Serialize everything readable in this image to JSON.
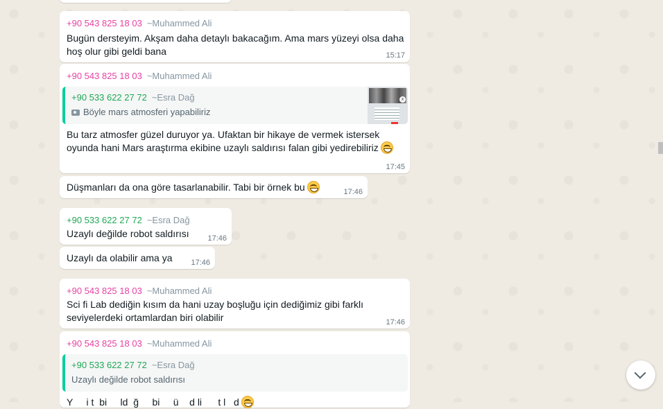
{
  "colors": {
    "background": "#efeae2",
    "bubble": "#ffffff",
    "sender_a": "#e542a3",
    "sender_b": "#1fa855",
    "quote_bar": "#06cf9c",
    "meta": "#667781"
  },
  "senders": {
    "ma": {
      "number": "+90 543 825 18 03",
      "alias": "~Muhammed Ali"
    },
    "ed": {
      "number": "+90 533 622 27 72",
      "alias": "~Esra Dağ"
    }
  },
  "messages": [
    {
      "id": "m1",
      "line1": "Bugün dersteyim. Akşam daha detaylı bakacağım. Ama mars yüzeyi olsa daha",
      "line2": "hoş olur gibi geldi bana",
      "time": "15:17"
    },
    {
      "id": "m2",
      "quote_text": "Böyle mars atmosferi yapabiliriz",
      "quote_icon": "camera-icon",
      "line1": "Bu tarz atmosfer güzel duruyor ya. Ufaktan bir hikaye de vermek istersek",
      "line2": "oyunda hani Mars araştırma ekibine uzaylı saldırısı falan gibi yedirebiliriz",
      "time": "17:45"
    },
    {
      "id": "m3",
      "line1": "Düşmanları da ona göre tasarlanabilir. Tabi bir örnek bu",
      "time": "17:46"
    },
    {
      "id": "m4",
      "line1": "Uzaylı değilde robot saldırısı",
      "time": "17:46"
    },
    {
      "id": "m5",
      "line1": "Uzaylı da olabilir ama ya",
      "time": "17:46"
    },
    {
      "id": "m6",
      "line1": "Sci fi Lab dediğin kısım da hani uzay boşluğu için dediğimiz gibi farklı",
      "line2": "seviyelerdeki ortamlardan biri olabilir",
      "time": "17:46"
    },
    {
      "id": "m7",
      "quote_text": "Uzaylı değilde robot saldırısı",
      "partial_line": "Y     i t  bi     ld  ğ     bi     ü    d li      t l   d"
    }
  ],
  "emoji": "grinning-face-icon",
  "scroll_button": "chevron-down-icon"
}
